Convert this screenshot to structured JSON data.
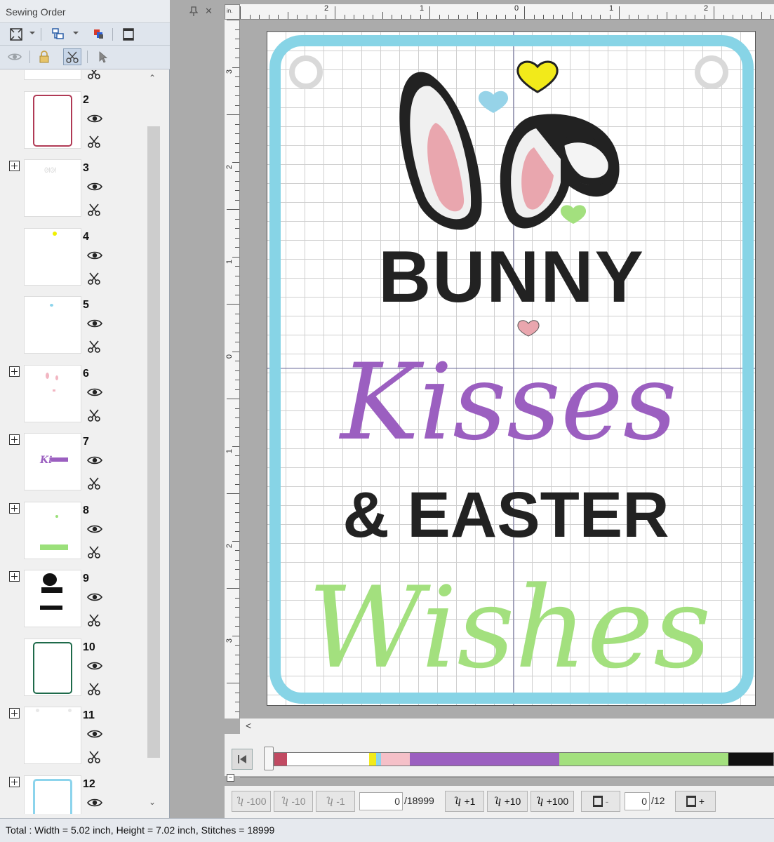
{
  "panel": {
    "title": "Sewing Order",
    "pin_symbol": "📌",
    "close_symbol": "✕"
  },
  "toolbar": {
    "top_icons": [
      "fit-view-icon",
      "group-order-icon",
      "color-order-icon",
      "hoop-frame-icon"
    ],
    "bottom_icons": [
      "eye-icon",
      "lock-icon",
      "cut-toggle-icon",
      "select-arrow-icon"
    ]
  },
  "sequence": [
    {
      "number": "",
      "thumb_color": "#2a6fb0"
    },
    {
      "number": "2",
      "thumb_color": "#b03a55"
    },
    {
      "number": "3",
      "thumb_color": "#dddddd"
    },
    {
      "number": "4",
      "thumb_color": "#f0f000"
    },
    {
      "number": "5",
      "thumb_color": "#8cd4ec"
    },
    {
      "number": "6",
      "thumb_color": "#f2b6c2"
    },
    {
      "number": "7",
      "thumb_color": "#9b5fc0"
    },
    {
      "number": "8",
      "thumb_color": "#9be07a"
    },
    {
      "number": "9",
      "thumb_color": "#111111"
    },
    {
      "number": "10",
      "thumb_color": "#1e6a4a"
    },
    {
      "number": "11",
      "thumb_color": "#f4f4f4"
    },
    {
      "number": "12",
      "thumb_color": "#8cd4ec"
    }
  ],
  "ruler": {
    "corner": "in.",
    "top_labels": [
      "2",
      "1",
      "0",
      "1",
      "2"
    ],
    "left_labels": [
      "3",
      "2",
      "1",
      "0",
      "1",
      "2",
      "3"
    ]
  },
  "design": {
    "line1": "BUNNY",
    "line2": "Kisses",
    "line3": "& EASTER",
    "line4": "Wishes",
    "colors": {
      "outline": "#87d4e6",
      "black": "#222222",
      "purple": "#9b5fc0",
      "green": "#a3e07e",
      "pink": "#e9a6ae",
      "yellow": "#f2ea1a",
      "blue": "#96d3e8"
    }
  },
  "color_bar": [
    {
      "color": "#c14a62",
      "share": 0.026
    },
    {
      "color": "#ffffff",
      "share": 0.17
    },
    {
      "color": "#f2ea1a",
      "share": 0.015
    },
    {
      "color": "#8cd4ec",
      "share": 0.01
    },
    {
      "color": "#f5c0c8",
      "share": 0.06
    },
    {
      "color": "#9b5fc0",
      "share": 0.31
    },
    {
      "color": "#a3e07e",
      "share": 0.35
    },
    {
      "color": "#111111",
      "share": 0.093
    }
  ],
  "stitch_nav": {
    "minus100": "-100",
    "minus10": "-10",
    "minus1": "-1",
    "plus1": "+1",
    "plus10": "+10",
    "plus100": "+100",
    "stitch_value": "0",
    "stitch_total": "/18999",
    "hoop_minus": "-",
    "hoop_value": "0",
    "hoop_total": "/12",
    "hoop_plus": "+",
    "stitch_glyph": "ﾘ"
  },
  "status": "Total : Width = 5.02 inch, Height = 7.02 inch, Stitches = 18999"
}
